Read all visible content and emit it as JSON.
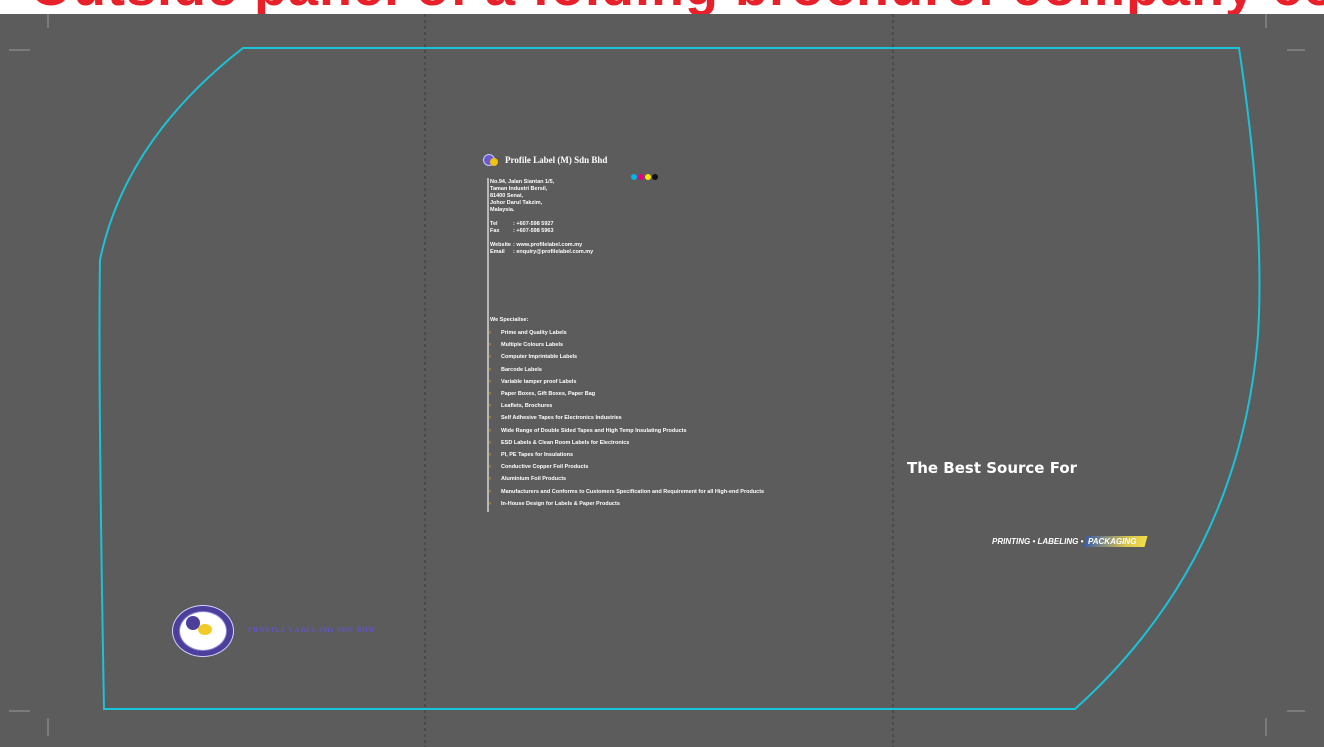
{
  "header": {
    "heading": "Outside panel of a folding brochure: company contact details, services list and slogan."
  },
  "company": {
    "name": "Profile Label (M) Sdn Bhd",
    "address_lines": [
      "No.94, Jalan Siantan 1/5,",
      "Taman Industri Bersil,",
      "81400 Senai,",
      "Johor Darul Takzim,",
      "Malaysia."
    ],
    "tel_label": "Tel",
    "tel_value": ": +607-598 5927",
    "fax_label": "Fax",
    "fax_value": ": +607-598 5963",
    "website_label": "Website",
    "website_value": ": www.profilelabel.com.my",
    "email_label": "Email",
    "email_value": ": enquiry@profilelabel.com.my",
    "cmyk_colors": [
      "#00b4e6",
      "#e6007e",
      "#ffe600",
      "#111111"
    ]
  },
  "specialise": {
    "heading": "We Specialise:",
    "items": [
      "Prime and Quality Labels",
      "Multiple Colours Labels",
      "Computer Imprintable Labels",
      "Barcode Labels",
      "Variable tamper proof Labels",
      "Paper Boxes, Gift Boxes, Paper Bag",
      "Leaflets, Brochures",
      "Self Adhesive Tapes for Electronics Industries",
      "Wide Range of Double Sided Tapes and High Temp Insulating Products",
      "ESD Labels & Clean Room Labels for Electronics",
      "PI, PE Tapes for Insulations",
      "Conductive Copper Foil Products",
      "Aluminium Foil Products",
      "Manufacturers and Conforms to Customers Specification and Requirement for all High-end Products",
      "In-House Design for Labels & Paper Products"
    ]
  },
  "slogan": {
    "tagline": "The Best Source For",
    "services_plain": "PRINTING • LABELING •",
    "services_highlight": "PACKAGING"
  },
  "seal": {
    "company_name": "PROFILE LABEL (M) SDN BHD"
  },
  "colors": {
    "background": "#5c5c5c",
    "cut_line": "#19c3d8",
    "heading_red": "#e8202a",
    "bullet_orange": "#f39c12",
    "seal_purple": "#4b3f9b"
  }
}
